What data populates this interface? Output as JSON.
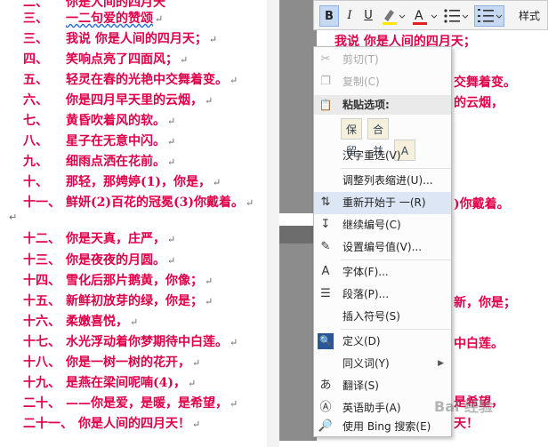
{
  "left_lines": [
    {
      "num": "二、",
      "text": "你是人间的四月天"
    },
    {
      "num": "三、",
      "text": "一二句爱的赞颂"
    },
    {
      "num": "三、",
      "text": "我说  你是人间的四月天；"
    },
    {
      "num": "四、",
      "text": "笑响点亮了四面风；"
    },
    {
      "num": "五、",
      "text": "轻灵在春的光艳中交舞着变。"
    },
    {
      "num": "六、",
      "text": "你是四月早天里的云烟，"
    },
    {
      "num": "七、",
      "text": "黄昏吹着风的软。"
    },
    {
      "num": "八、",
      "text": "星子在无意中闪。"
    },
    {
      "num": "九、",
      "text": "细雨点洒在花前。"
    },
    {
      "num": "十、",
      "text": "那轻，那娉婷(1)，你是，"
    },
    {
      "num": "十一、",
      "text": "鲜妍(2)百花的冠冕(3)你戴着。"
    },
    {
      "num": "十二、",
      "text": "你是天真，庄严，"
    },
    {
      "num": "十三、",
      "text": "你是夜夜的月圆。"
    },
    {
      "num": "十四、",
      "text": "雪化后那片鹅黄，你像；"
    },
    {
      "num": "十五、",
      "text": "新鲜初放芽的绿，你是；"
    },
    {
      "num": "十六、",
      "text": "柔嫩喜悦，"
    },
    {
      "num": "十七、",
      "text": "水光浮动着你梦期待中白莲。"
    },
    {
      "num": "十八、",
      "text": "你是一树一树的花开，"
    },
    {
      "num": "十九、",
      "text": "是燕在梁间呢喃(4)，"
    },
    {
      "num": "二十、",
      "text": "——你是爱，是暖，是希望，"
    },
    {
      "num": "二十一、",
      "text": "你是人间的四月天！"
    }
  ],
  "right_fragments": [
    {
      "text": "我说  你是人间的四月天；"
    },
    {
      "text": "交舞着变。"
    },
    {
      "text": "的云烟，"
    },
    {
      "text": ")你戴着。"
    },
    {
      "text": "中白莲。"
    },
    {
      "text": "新，你是；"
    },
    {
      "text": "是希望，"
    },
    {
      "text": "天！"
    }
  ],
  "toolbar": {
    "bold": "B",
    "italic": "I",
    "underline": "U",
    "styles": "样式"
  },
  "menu": {
    "cut": "剪切(T)",
    "copy": "复制(C)",
    "paste_options": "粘贴选项:",
    "paste_icons": [
      "保留",
      "合并",
      "A"
    ],
    "hanzi_reselect": "汉字重选(V)",
    "adjust_indent": "调整列表缩进(U)...",
    "restart_numbering": "重新开始于 一(R)",
    "continue_numbering": "继续编号(C)",
    "set_number_value": "设置编号值(V)...",
    "font": "字体(F)...",
    "paragraph": "段落(P)...",
    "insert_symbol": "插入符号(S)",
    "define": "定义(D)",
    "synonyms": "同义词(Y)",
    "translate": "翻译(S)",
    "english_assistant": "英语助手(A)",
    "bing_search": "使用 Bing 搜索(E)"
  },
  "watermark": "Bai 经验",
  "colors": {
    "poem_text": "#e0004a",
    "highlight_blue": "#c7d9f2",
    "menu_active": "#dce6f4"
  }
}
